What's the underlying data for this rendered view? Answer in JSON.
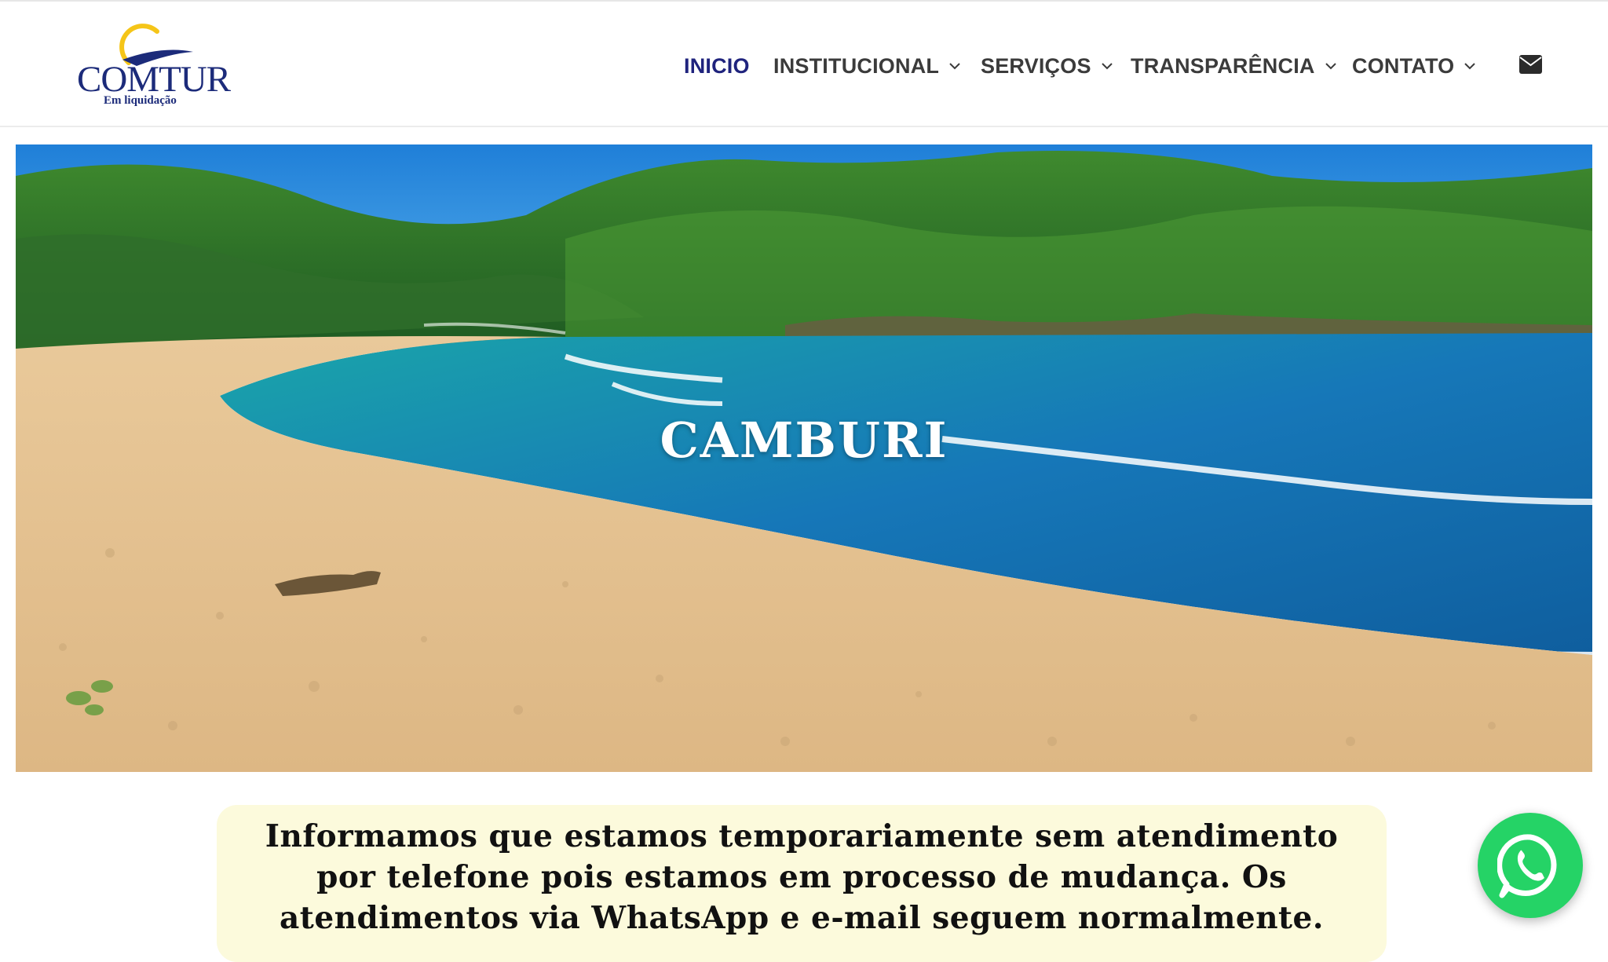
{
  "logo": {
    "name": "COMTUR",
    "subtitle": "Em liquidação",
    "colors": {
      "navy": "#1c2b7a",
      "sun": "#f5c518"
    }
  },
  "nav": {
    "items": [
      {
        "label": "INICIO",
        "active": true,
        "dropdown": false
      },
      {
        "label": "INSTITUCIONAL",
        "active": false,
        "dropdown": true
      },
      {
        "label": "SERVIÇOS",
        "active": false,
        "dropdown": true
      },
      {
        "label": "TRANSPARÊNCIA",
        "active": false,
        "dropdown": true
      },
      {
        "label": "CONTATO",
        "active": false,
        "dropdown": true
      }
    ],
    "mail_icon": "envelope-icon",
    "colors": {
      "active": "#1f237d",
      "default": "#3b3b3b"
    }
  },
  "hero": {
    "title": "CAMBURI"
  },
  "notice": {
    "text": "Informamos que estamos temporariamente sem atendimento por telefone pois estamos em processo de mudança. Os atendimentos via WhatsApp e e-mail seguem normalmente.",
    "background": "#fcfadc"
  },
  "whatsapp": {
    "icon": "whatsapp-icon",
    "color": "#25d366"
  }
}
